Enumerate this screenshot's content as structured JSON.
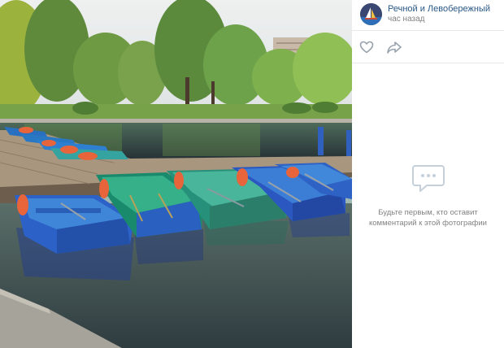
{
  "post": {
    "author": "Речной и Левобережный",
    "time": "час назад"
  },
  "actions": {
    "like_icon": "heart-outline-icon",
    "share_icon": "share-arrow-icon"
  },
  "comments": {
    "icon": "speech-bubble-icon",
    "empty_line1": "Будьте первым, кто оставит",
    "empty_line2": "комментарий к этой фотографии"
  },
  "photo": {
    "subject": "boats-on-pond"
  },
  "colors": {
    "link": "#2a5885",
    "muted": "#828282",
    "divider": "#e7e8ec",
    "icon": "#99a2ad"
  }
}
